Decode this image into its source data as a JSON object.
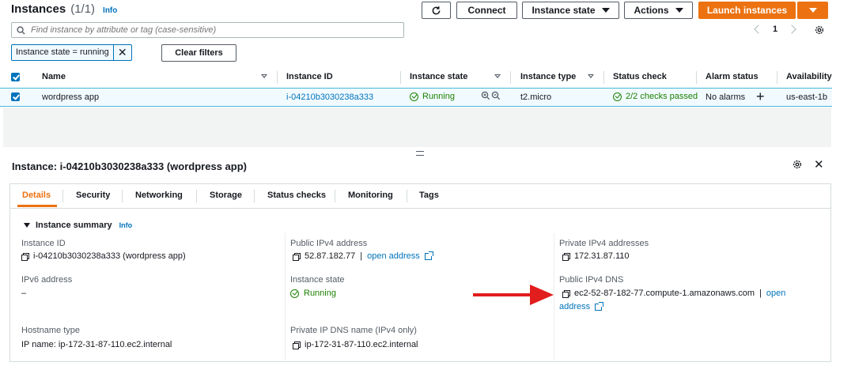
{
  "header": {
    "title": "Instances",
    "count": "(1/1)",
    "info": "Info",
    "connect": "Connect",
    "instance_state": "Instance state",
    "actions": "Actions",
    "launch": "Launch instances"
  },
  "search": {
    "placeholder": "Find instance by attribute or tag (case-sensitive)"
  },
  "pagination": {
    "page": "1"
  },
  "filter": {
    "token": "Instance state = running",
    "clear": "Clear filters"
  },
  "table": {
    "headers": [
      "Name",
      "Instance ID",
      "Instance state",
      "Instance type",
      "Status check",
      "Alarm status",
      "Availability"
    ],
    "row": {
      "name": "wordpress app",
      "id": "i-04210b3030238a333",
      "state": "Running",
      "type": "t2.micro",
      "status": "2/2 checks passed",
      "alarm": "No alarms",
      "az": "us-east-1b"
    }
  },
  "detail": {
    "title": "Instance: i-04210b3030238a333 (wordpress app)",
    "tabs": [
      "Details",
      "Security",
      "Networking",
      "Storage",
      "Status checks",
      "Monitoring",
      "Tags"
    ],
    "summary_title": "Instance summary",
    "summary_info": "Info",
    "instance_id_label": "Instance ID",
    "instance_id_value": "i-04210b3030238a333 (wordpress app)",
    "public_ipv4_label": "Public IPv4 address",
    "public_ipv4_value": "52.87.182.77",
    "public_ipv4_sep": "|",
    "open_address": "open address",
    "private_ipv4_label": "Private IPv4 addresses",
    "private_ipv4_value": "172.31.87.110",
    "ipv6_label": "IPv6 address",
    "ipv6_value": "–",
    "state_label": "Instance state",
    "state_value": "Running",
    "public_dns_label": "Public IPv4 DNS",
    "public_dns_value": "ec2-52-87-182-77.compute-1.amazonaws.com",
    "public_dns_sep": "|",
    "open_part1": "open",
    "open_part2": "address",
    "hostname_label": "Hostname type",
    "hostname_value": "IP name: ip-172-31-87-110.ec2.internal",
    "private_dns_label": "Private IP DNS name (IPv4 only)",
    "private_dns_value": "ip-172-31-87-110.ec2.internal"
  },
  "colors": {
    "accent": "#ec7211",
    "link": "#0073bb",
    "success": "#1d8102",
    "arrow": "#e11d1d"
  }
}
